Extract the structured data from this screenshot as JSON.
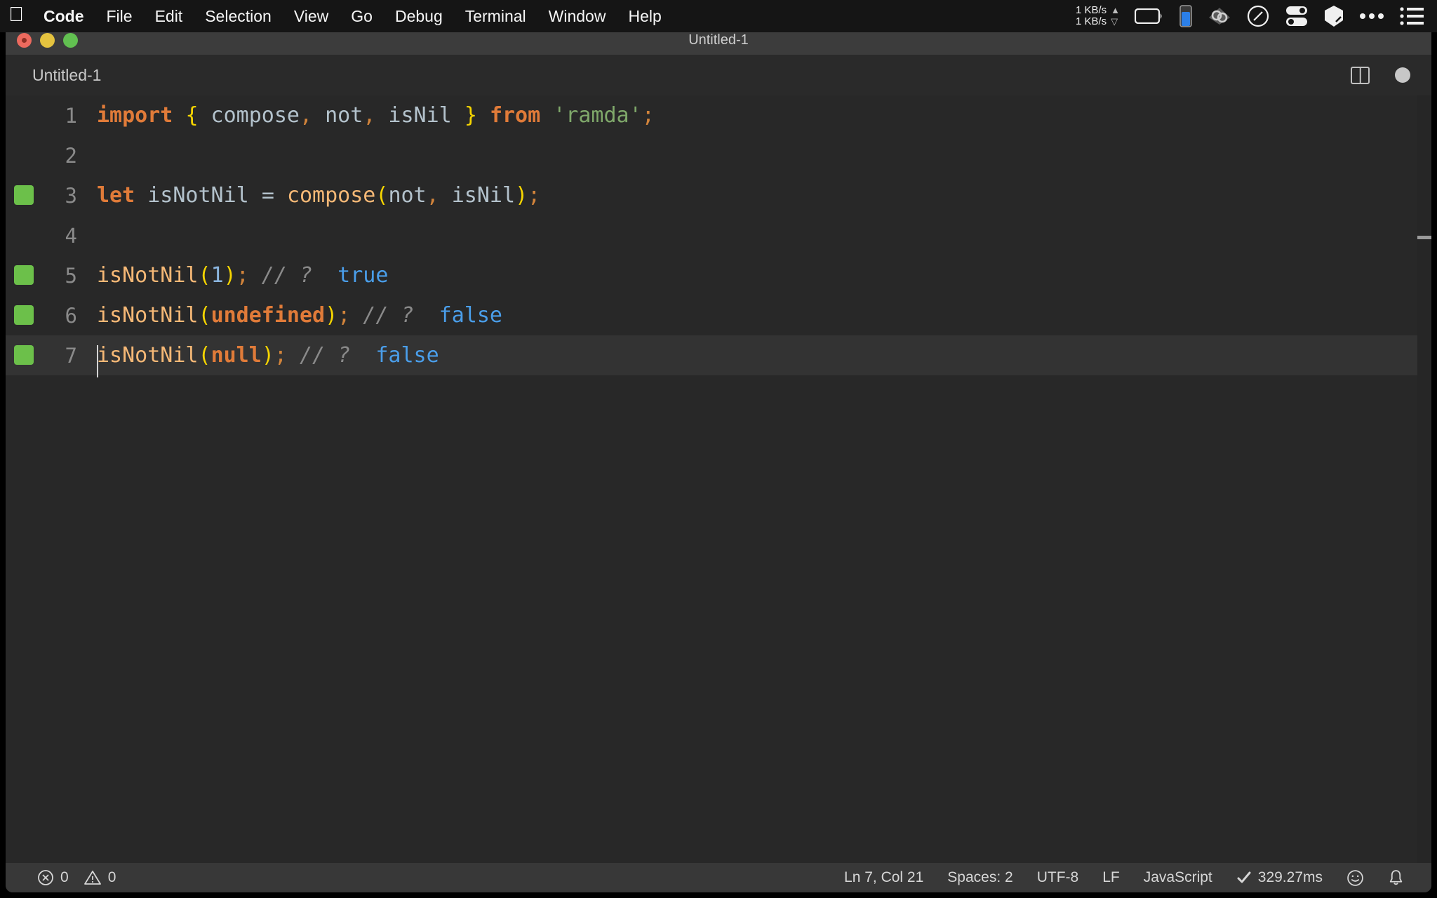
{
  "menubar": {
    "apple_icon": "apple-logo-icon",
    "items": [
      {
        "label": "Code",
        "bold": true
      },
      {
        "label": "File",
        "bold": false
      },
      {
        "label": "Edit",
        "bold": false
      },
      {
        "label": "Selection",
        "bold": false
      },
      {
        "label": "View",
        "bold": false
      },
      {
        "label": "Go",
        "bold": false
      },
      {
        "label": "Debug",
        "bold": false
      },
      {
        "label": "Terminal",
        "bold": false
      },
      {
        "label": "Window",
        "bold": false
      },
      {
        "label": "Help",
        "bold": false
      }
    ],
    "network": {
      "upload": "1 KB/s",
      "download": "1 KB/s",
      "up_arrow": "▲",
      "down_arrow": "▽"
    },
    "tray_icons": [
      "battery-icon",
      "blue-meter-icon",
      "cloud-sync-icon",
      "do-not-disturb-icon",
      "toggles-icon",
      "bookmark-icon",
      "ellipsis-icon",
      "list-menu-icon"
    ]
  },
  "window": {
    "title": "Untitled-1",
    "traffic_lights": [
      "close",
      "minimize",
      "zoom"
    ]
  },
  "tab": {
    "label": "Untitled-1",
    "split_editor_icon": "split-editor-icon",
    "dirty_indicator": "unsaved-dot-icon"
  },
  "editor": {
    "language": "JavaScript",
    "lines": [
      {
        "number": "1",
        "marker": false,
        "active": false,
        "tokens": [
          {
            "text": "import",
            "type": "kw"
          },
          {
            "text": " ",
            "type": "op"
          },
          {
            "text": "{",
            "type": "brace"
          },
          {
            "text": " compose",
            "type": "var"
          },
          {
            "text": ",",
            "type": "punc"
          },
          {
            "text": " not",
            "type": "var"
          },
          {
            "text": ",",
            "type": "punc"
          },
          {
            "text": " isNil ",
            "type": "var"
          },
          {
            "text": "}",
            "type": "brace"
          },
          {
            "text": " ",
            "type": "op"
          },
          {
            "text": "from",
            "type": "kw"
          },
          {
            "text": " ",
            "type": "op"
          },
          {
            "text": "'ramda'",
            "type": "string"
          },
          {
            "text": ";",
            "type": "punc"
          }
        ]
      },
      {
        "number": "2",
        "marker": false,
        "active": false,
        "tokens": []
      },
      {
        "number": "3",
        "marker": true,
        "active": false,
        "tokens": [
          {
            "text": "let",
            "type": "kw"
          },
          {
            "text": " isNotNil ",
            "type": "var"
          },
          {
            "text": "=",
            "type": "op"
          },
          {
            "text": " ",
            "type": "op"
          },
          {
            "text": "compose",
            "type": "func"
          },
          {
            "text": "(",
            "type": "brace"
          },
          {
            "text": "not",
            "type": "var"
          },
          {
            "text": ",",
            "type": "punc"
          },
          {
            "text": " isNil",
            "type": "var"
          },
          {
            "text": ")",
            "type": "brace"
          },
          {
            "text": ";",
            "type": "punc"
          }
        ]
      },
      {
        "number": "4",
        "marker": false,
        "active": false,
        "tokens": []
      },
      {
        "number": "5",
        "marker": true,
        "active": false,
        "tokens": [
          {
            "text": "isNotNil",
            "type": "func"
          },
          {
            "text": "(",
            "type": "brace"
          },
          {
            "text": "1",
            "type": "num"
          },
          {
            "text": ")",
            "type": "brace"
          },
          {
            "text": ";",
            "type": "punc"
          },
          {
            "text": " // ?",
            "type": "comment"
          },
          {
            "text": "  true",
            "type": "result"
          }
        ]
      },
      {
        "number": "6",
        "marker": true,
        "active": false,
        "tokens": [
          {
            "text": "isNotNil",
            "type": "func"
          },
          {
            "text": "(",
            "type": "brace"
          },
          {
            "text": "undefined",
            "type": "const"
          },
          {
            "text": ")",
            "type": "brace"
          },
          {
            "text": ";",
            "type": "punc"
          },
          {
            "text": " // ?",
            "type": "comment"
          },
          {
            "text": "  false",
            "type": "result"
          }
        ]
      },
      {
        "number": "7",
        "marker": true,
        "active": true,
        "tokens": [
          {
            "text": "isNotNil",
            "type": "func"
          },
          {
            "text": "(",
            "type": "brace"
          },
          {
            "text": "null",
            "type": "const"
          },
          {
            "text": ")",
            "type": "brace"
          },
          {
            "text": ";",
            "type": "punc"
          },
          {
            "text": " // ?",
            "type": "comment"
          },
          {
            "text": "  false",
            "type": "result"
          }
        ]
      }
    ]
  },
  "statusbar": {
    "errors": "0",
    "warnings": "0",
    "error_icon": "error-circle-icon",
    "warning_icon": "warning-triangle-icon",
    "cursor_position": "Ln 7, Col 21",
    "indentation": "Spaces: 2",
    "encoding": "UTF-8",
    "eol": "LF",
    "language_mode": "JavaScript",
    "run_status": "329.27ms",
    "run_status_icon": "checkmark-icon",
    "feedback_icon": "smiley-icon",
    "notifications_icon": "bell-icon"
  },
  "colors": {
    "editor_background": "#282828",
    "titlebar_background": "#3c3c3c",
    "statusbar_background": "#383838",
    "accent_green": "#6cc04a",
    "keyword_orange": "#e07b39",
    "string_green": "#7fa86a",
    "brace_yellow": "#f6d500",
    "result_blue": "#4a9eea"
  }
}
